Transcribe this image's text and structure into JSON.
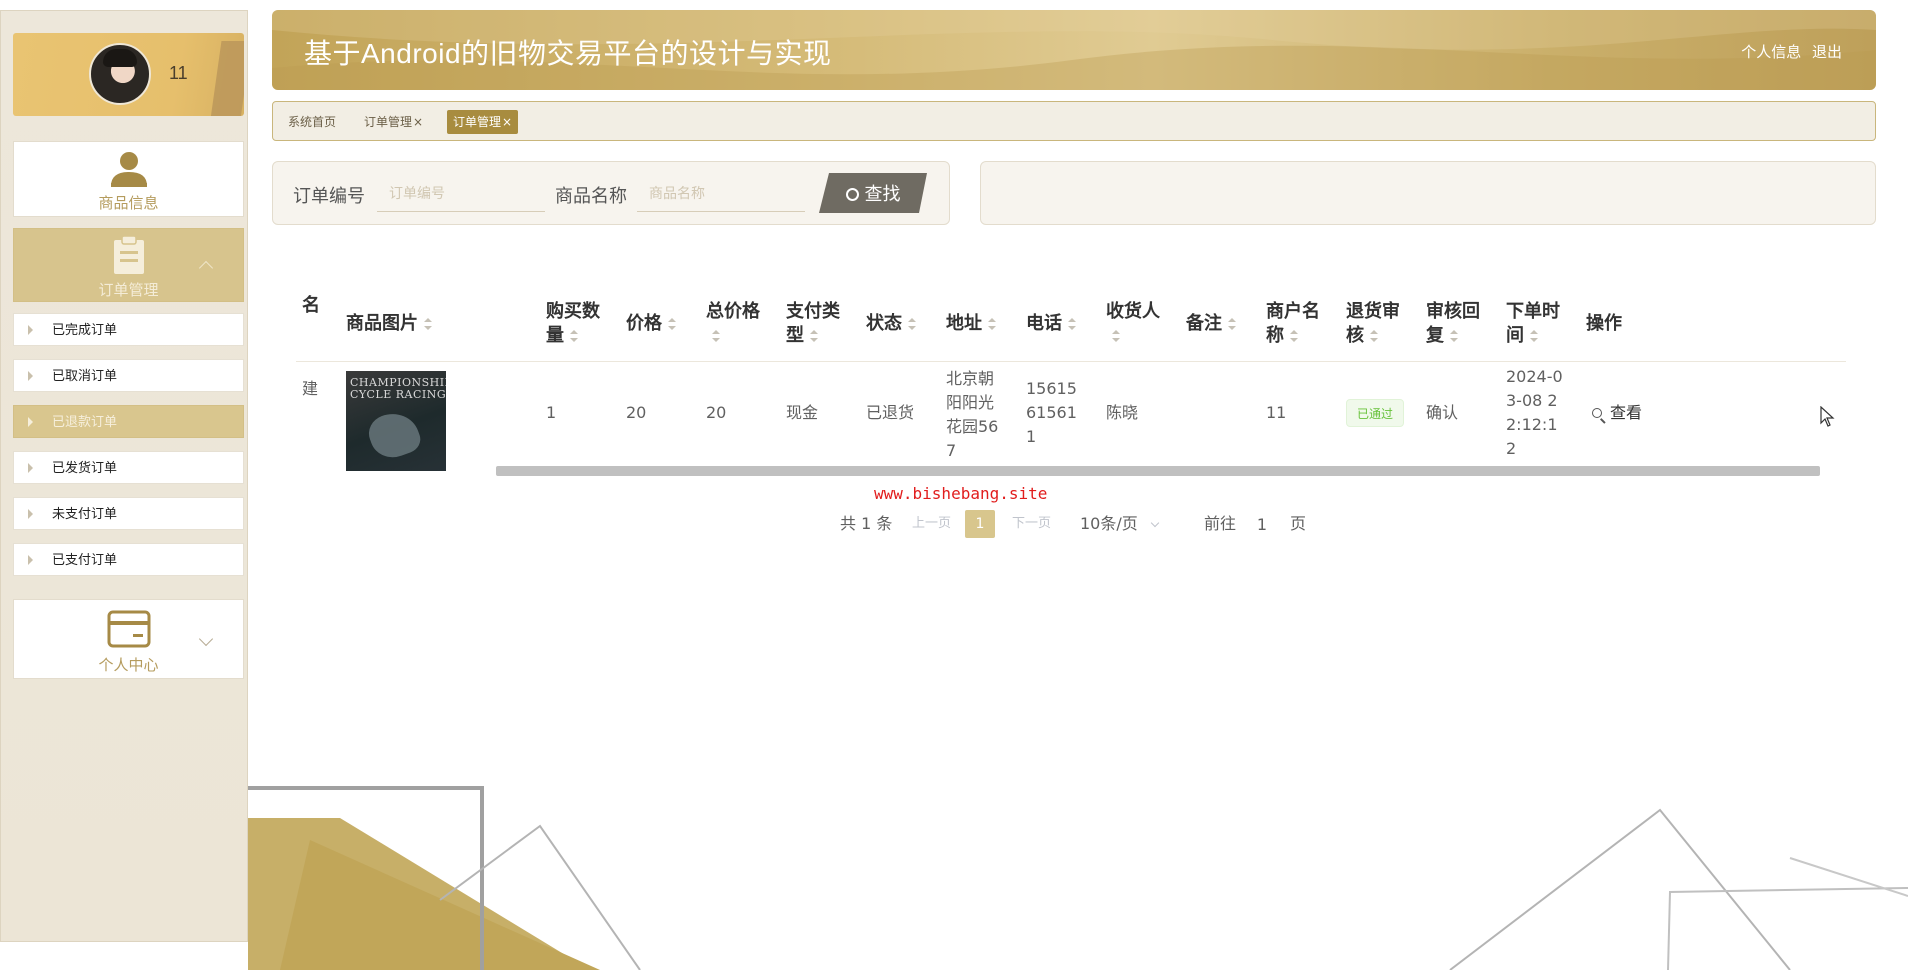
{
  "app": {
    "title": "基于Android的旧物交易平台的设计与实现",
    "header_links": [
      "个人信息",
      "退出"
    ]
  },
  "sidebar": {
    "user_name": "11",
    "menus": [
      {
        "label": "商品信息",
        "icon": "person-icon"
      },
      {
        "label": "订单管理",
        "icon": "clipboard-icon",
        "expanded": true
      },
      {
        "label": "个人中心",
        "icon": "card-icon",
        "expanded": false
      }
    ],
    "order_items": [
      {
        "label": "已完成订单",
        "active": false
      },
      {
        "label": "已取消订单",
        "active": false
      },
      {
        "label": "已退款订单",
        "active": true
      },
      {
        "label": "已发货订单",
        "active": false
      },
      {
        "label": "未支付订单",
        "active": false
      },
      {
        "label": "已支付订单",
        "active": false
      }
    ]
  },
  "tabs": [
    {
      "label": "系统首页",
      "closable": false,
      "active": false
    },
    {
      "label": "订单管理",
      "closable": true,
      "active": false
    },
    {
      "label": "订单管理",
      "closable": true,
      "active": true
    }
  ],
  "search": {
    "order_no_label": "订单编号",
    "order_no_placeholder": "订单编号",
    "order_no_value": "",
    "product_name_label": "商品名称",
    "product_name_placeholder": "商品名称",
    "product_name_value": "",
    "button_label": "查找"
  },
  "table": {
    "columns": [
      "名",
      "商品图片",
      "购买数量",
      "价格",
      "总价格",
      "支付类型",
      "状态",
      "地址",
      "电话",
      "收货人",
      "备注",
      "商户名称",
      "退货审核",
      "审核回复",
      "下单时间",
      "操作"
    ],
    "rows": [
      {
        "name_fragment": "建",
        "image_caption": "CHAMPIONSHIP CYCLE RACING",
        "quantity": "1",
        "price": "20",
        "total": "20",
        "pay_type": "现金",
        "status": "已退货",
        "address": "北京朝阳阳光花园567",
        "phone": "15615615611",
        "receiver": "陈晓",
        "note": "",
        "merchant": "11",
        "return_review": "已通过",
        "review_reply": "确认",
        "order_time": "2024-03-08 22:12:12",
        "action": "查看"
      }
    ]
  },
  "watermark": "www.bishebang.site",
  "pagination": {
    "total_text": "共 1 条",
    "prev": "上一页",
    "current": "1",
    "next": "下一页",
    "page_size": "10条/页",
    "goto_label": "前往",
    "goto_value": "1",
    "page_unit": "页"
  },
  "colors": {
    "brand_gold": "#c2a458",
    "active_item": "#d9c68e",
    "tag_green": "#67c23a"
  }
}
